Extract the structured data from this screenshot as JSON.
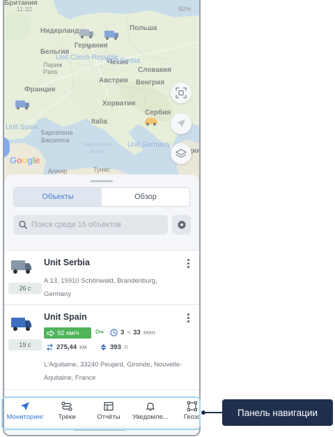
{
  "status_bar": {
    "time": "11:32",
    "battery": "92%"
  },
  "map": {
    "labels": {
      "britain": "Британия",
      "netherlands": "Нидерланды",
      "poland": "Польша",
      "germany": "Германия",
      "belgium": "Бельгия",
      "paris": "Париж",
      "paris_en": "Paris",
      "czech": "Чехия",
      "slovakia": "Словакия",
      "austria": "Австрия",
      "hungary": "Венгрия",
      "france": "Франция",
      "croatia": "Хорватия",
      "serbia": "Сербия",
      "italy": "Italia",
      "barcelona": "Барселона",
      "barcelona_en": "Barcelona",
      "tyrrhenian_sea": "Тирренское море",
      "greece": "Греция",
      "algiers": "Алжир",
      "tunis": "Тунис"
    },
    "unit_labels": {
      "czech_republic": "Unit Czech Republic",
      "serbia": "Unit Serbia",
      "spain": "Unit Spain",
      "germany": "Unit Germany"
    },
    "google_logo": "Google",
    "buttons": [
      "fit-bounds-icon",
      "navigation-arrow-icon",
      "layers-icon"
    ]
  },
  "tabs": {
    "objects": "Объекты",
    "overview": "Обзор",
    "active": "objects"
  },
  "search": {
    "placeholder": "Поиск среди 15 объектов",
    "value": ""
  },
  "units": [
    {
      "name": "Unit Serbia",
      "age": "26 с",
      "address": "A 13, 15910 Schönwald, Brandenburg, Germany"
    },
    {
      "name": "Unit Spain",
      "age": "19 с",
      "speed": "92 км/ч",
      "ignition_icon": "key-icon",
      "duration_num1": "3",
      "duration_u1": "ч",
      "duration_num2": "33",
      "duration_u2": "мин",
      "mileage": "275,44",
      "mileage_unit": "км",
      "fuel": "393",
      "fuel_unit": "л",
      "address": "L'Aquitaine, 33240 Peujard, Gironde, Nouvelle-Aquitaine, France"
    }
  ],
  "nav": {
    "items": [
      {
        "label": "Мониторинг",
        "icon": "navigation-arrow-icon"
      },
      {
        "label": "Треки",
        "icon": "route-icon"
      },
      {
        "label": "Отчёты",
        "icon": "report-table-icon"
      },
      {
        "label": "Уведомле...",
        "icon": "bell-icon"
      },
      {
        "label": "Геозо",
        "icon": "geofence-icon"
      }
    ],
    "active": "Мониторинг"
  },
  "callout": {
    "text": "Панель навигации"
  },
  "colors": {
    "accent": "#2f74d6",
    "speed_badge": "#4fb35a",
    "callout_bg": "#1f2f4d",
    "highlight_frame": "#9fd8ea"
  }
}
